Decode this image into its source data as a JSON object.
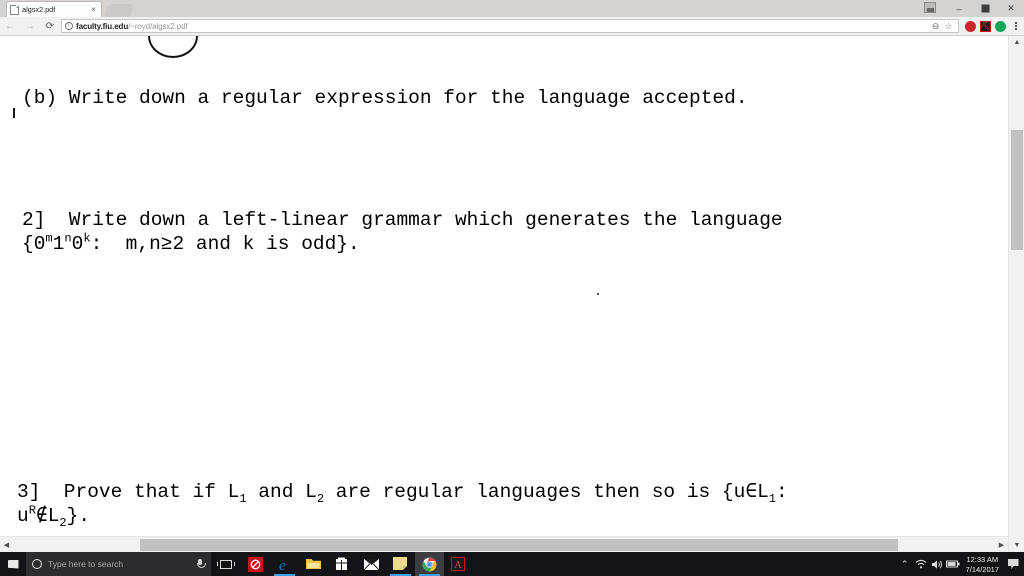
{
  "browser": {
    "tab": {
      "title": "algsx2.pdf",
      "close_label": "×",
      "favicon": "page-icon"
    },
    "new_tab_label": "",
    "window_controls": {
      "minimize": "–",
      "restore": "❐",
      "close": "✕"
    },
    "nav": {
      "back": "←",
      "forward": "→",
      "reload": "⟳"
    },
    "omnibox": {
      "info_icon": "i",
      "url_host": "faculty.fiu.edu",
      "url_path": "/~royd/algsx2.pdf",
      "zoom_icon": "⊖",
      "bookmark_icon": "☆"
    },
    "extensions": [
      {
        "name": "adblock-extension",
        "color": "#c9252b",
        "glyph": ""
      },
      {
        "name": "adobe-acrobat-extension",
        "color": "#1a1a1a",
        "glyph": "⛏"
      },
      {
        "name": "grammar-extension",
        "color": "#15a65a",
        "glyph": ""
      }
    ],
    "menu_label": "⋮"
  },
  "pdf": {
    "lines": [
      {
        "id": "question-1b",
        "text": "(b) Write down a regular expression for the language accepted."
      },
      {
        "id": "question-2-line1",
        "text": "2]  Write down a left-linear grammar which generates the language"
      },
      {
        "id": "question-2-line2",
        "text": "{0m1n0k:  m,n≥2 and k is odd}."
      },
      {
        "id": "question-3-line1",
        "text": "3]  Prove that if L1 and L2 are regular languages then so is {u∈L1:"
      },
      {
        "id": "question-3-line2",
        "text": "uR∉L2}."
      }
    ],
    "q2_l2_parts": {
      "open": "{0",
      "m": "m",
      "one": "1",
      "n": "n",
      "zero": "0",
      "k": "k",
      "tail": ":  m,n≥2 and k is odd}."
    },
    "q3_l1_parts": {
      "a": "3]  Prove that if L",
      "s1": "1",
      "b": " and L",
      "s2": "2",
      "c": " are regular languages then so is {u∈L",
      "s3": "1",
      "d": ":"
    },
    "q3_l2_parts": {
      "a": "u",
      "sup": "R",
      "b": "∉L",
      "sub": "2",
      "c": "}."
    },
    "scrollbars": {
      "up_arrow": "▲",
      "down_arrow": "▼",
      "left_arrow": "◀",
      "right_arrow": "▶"
    }
  },
  "taskbar": {
    "start_label": "start-button",
    "search_placeholder": "Type here to search",
    "mic_label": "microphone-icon",
    "taskview_label": "task-view-icon",
    "apps": [
      {
        "name": "app-redshield",
        "color": "#c4161c",
        "glyph": "◎",
        "running": false
      },
      {
        "name": "microsoft-edge",
        "color": "#0c7ec4",
        "glyph": "e",
        "running": true
      },
      {
        "name": "file-explorer",
        "color": "#f5c24a",
        "glyph": "",
        "running": false
      },
      {
        "name": "microsoft-store",
        "color": "#ffffff",
        "glyph": "⊞",
        "running": false
      },
      {
        "name": "mail-app",
        "color": "#ffffff",
        "glyph": "✉",
        "running": false
      },
      {
        "name": "sticky-notes",
        "color": "#ecdc8a",
        "glyph": "",
        "running": true
      },
      {
        "name": "google-chrome",
        "color": "#4285f4",
        "glyph": "",
        "running": true
      },
      {
        "name": "adobe-acrobat",
        "color": "#c4161c",
        "glyph": "⛏",
        "running": false
      }
    ],
    "tray": {
      "chevron": "⌃",
      "wifi": "◠",
      "volume": "🔊",
      "battery": "▬",
      "time": "12:33 AM",
      "date": "7/14/2017",
      "notifications_label": "action-center-icon"
    }
  }
}
